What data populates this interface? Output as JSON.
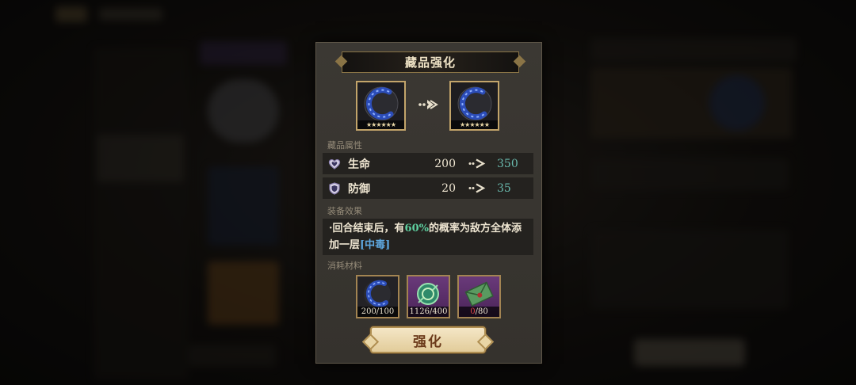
{
  "dialog": {
    "title": "藏品强化",
    "item": {
      "stars_before": "★★★★★★",
      "stars_after": "★★★★★★"
    },
    "attributes_label": "藏品属性",
    "stats": [
      {
        "name": "生命",
        "current": "200",
        "next": "350"
      },
      {
        "name": "防御",
        "current": "20",
        "next": "35"
      }
    ],
    "effect_label": "装备效果",
    "effect": {
      "part1": "·回合结束后，有",
      "chance": "60%",
      "part2": "的概率为敌方全体添加一层",
      "status": "[中毒]"
    },
    "materials_label": "消耗材料",
    "materials": [
      {
        "name": "collection-item",
        "count": "200/100"
      },
      {
        "name": "green-orb-material",
        "count": "1126/400"
      },
      {
        "name": "green-letter-material",
        "have": "0",
        "need": "/80"
      }
    ],
    "enhance_button": "强化"
  },
  "colors": {
    "accent_gold": "#c2a46a",
    "new_value_teal": "#69b9ad",
    "highlight_green": "#5ed0a0",
    "highlight_blue": "#5ea8e0",
    "insufficient_red": "#e04848"
  }
}
